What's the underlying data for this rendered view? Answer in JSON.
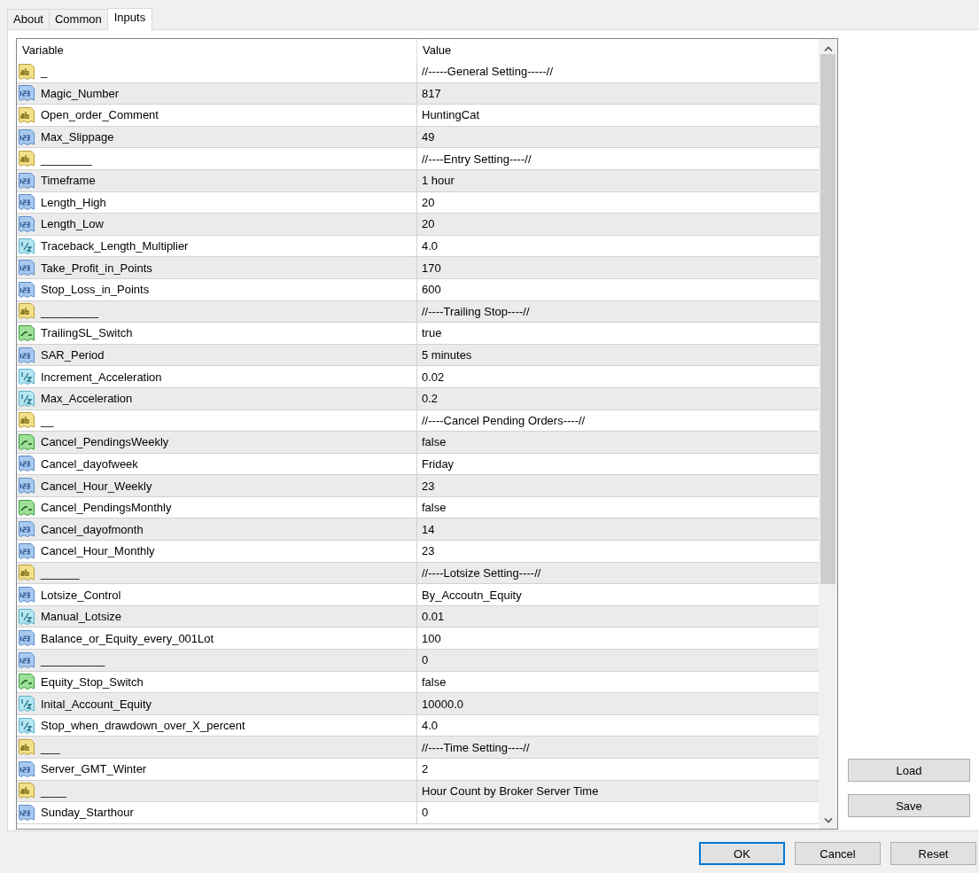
{
  "tabs": [
    {
      "label": "About",
      "selected": false
    },
    {
      "label": "Common",
      "selected": false
    },
    {
      "label": "Inputs",
      "selected": true
    }
  ],
  "table": {
    "columns": [
      "Variable",
      "Value"
    ],
    "rows": [
      {
        "kind": "string",
        "variable": "_",
        "value": "//-----General Setting-----//"
      },
      {
        "kind": "int",
        "variable": "Magic_Number",
        "value": "817"
      },
      {
        "kind": "string",
        "variable": "Open_order_Comment",
        "value": "HuntingCat"
      },
      {
        "kind": "int",
        "variable": "Max_Slippage",
        "value": "49"
      },
      {
        "kind": "string",
        "variable": "________",
        "value": "//----Entry Setting----//"
      },
      {
        "kind": "int",
        "variable": "Timeframe",
        "value": "1 hour"
      },
      {
        "kind": "int",
        "variable": "Length_High",
        "value": "20"
      },
      {
        "kind": "int",
        "variable": "Length_Low",
        "value": "20"
      },
      {
        "kind": "double",
        "variable": "Traceback_Length_Multiplier",
        "value": "4.0"
      },
      {
        "kind": "int",
        "variable": "Take_Profit_in_Points",
        "value": "170"
      },
      {
        "kind": "int",
        "variable": "Stop_Loss_in_Points",
        "value": "600"
      },
      {
        "kind": "string",
        "variable": "_________",
        "value": "//----Trailing Stop----//"
      },
      {
        "kind": "bool",
        "variable": "TrailingSL_Switch",
        "value": "true"
      },
      {
        "kind": "int",
        "variable": "SAR_Period",
        "value": "5 minutes"
      },
      {
        "kind": "double",
        "variable": "Increment_Acceleration",
        "value": "0.02"
      },
      {
        "kind": "double",
        "variable": "Max_Acceleration",
        "value": "0.2"
      },
      {
        "kind": "string",
        "variable": "__",
        "value": "//----Cancel Pending Orders----//"
      },
      {
        "kind": "bool",
        "variable": "Cancel_PendingsWeekly",
        "value": "false"
      },
      {
        "kind": "int",
        "variable": "Cancel_dayofweek",
        "value": "Friday"
      },
      {
        "kind": "int",
        "variable": "Cancel_Hour_Weekly",
        "value": "23"
      },
      {
        "kind": "bool",
        "variable": "Cancel_PendingsMonthly",
        "value": "false"
      },
      {
        "kind": "int",
        "variable": "Cancel_dayofmonth",
        "value": "14"
      },
      {
        "kind": "int",
        "variable": "Cancel_Hour_Monthly",
        "value": "23"
      },
      {
        "kind": "string",
        "variable": "______",
        "value": "//----Lotsize Setting----//"
      },
      {
        "kind": "int",
        "variable": "Lotsize_Control",
        "value": "By_Accoutn_Equity"
      },
      {
        "kind": "double",
        "variable": "Manual_Lotsize",
        "value": "0.01"
      },
      {
        "kind": "int",
        "variable": "Balance_or_Equity_every_001Lot",
        "value": "100"
      },
      {
        "kind": "int",
        "variable": "__________",
        "value": "0"
      },
      {
        "kind": "bool",
        "variable": "Equity_Stop_Switch",
        "value": "false"
      },
      {
        "kind": "double",
        "variable": "Inital_Account_Equity",
        "value": "10000.0"
      },
      {
        "kind": "double",
        "variable": "Stop_when_drawdown_over_X_percent",
        "value": "4.0"
      },
      {
        "kind": "string",
        "variable": "___",
        "value": "//----Time Setting----//"
      },
      {
        "kind": "int",
        "variable": "Server_GMT_Winter",
        "value": "2"
      },
      {
        "kind": "string",
        "variable": "____",
        "value": "Hour Count by Broker Server Time"
      },
      {
        "kind": "int",
        "variable": "Sunday_Starthour",
        "value": "0"
      }
    ]
  },
  "side_buttons": [
    "Load",
    "Save"
  ],
  "buttons": [
    {
      "label": "OK",
      "default": true
    },
    {
      "label": "Cancel",
      "default": false
    },
    {
      "label": "Reset",
      "default": false
    }
  ]
}
